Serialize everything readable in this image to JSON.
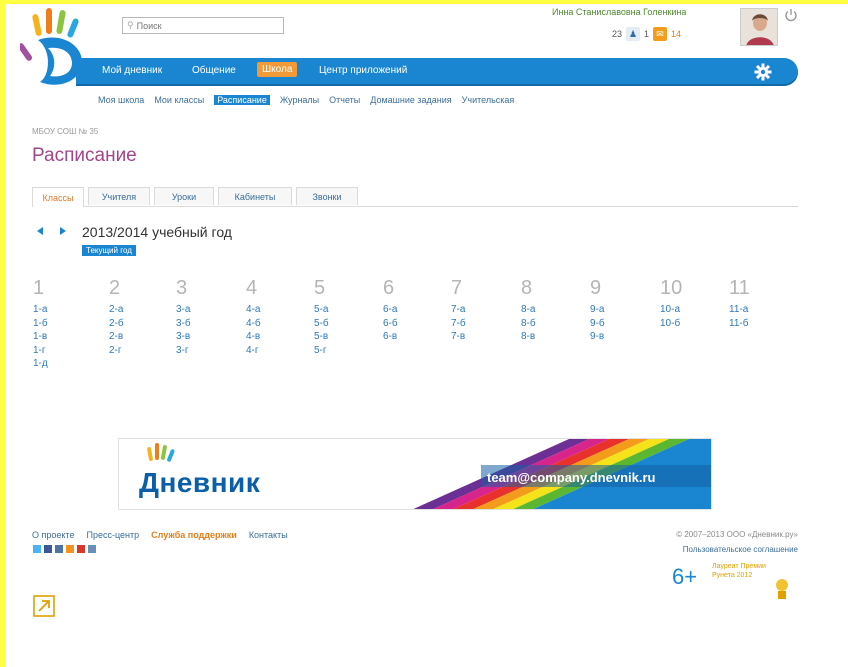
{
  "search": {
    "placeholder": "Поиск"
  },
  "user": {
    "name": "Инна Станиславовна Голенкина",
    "count_left": "23",
    "count_mid": "1",
    "count_messages": "14"
  },
  "nav": {
    "items": [
      "Мой дневник",
      "Общение",
      "Школа",
      "Центр приложений"
    ],
    "active": "Школа"
  },
  "subnav": {
    "items": [
      "Моя школа",
      "Мои классы",
      "Расписание",
      "Журналы",
      "Отчеты",
      "Домашние задания",
      "Учительская"
    ],
    "active": "Расписание"
  },
  "breadcrumb": "МБОУ СОШ № 35",
  "page_title": "Расписание",
  "tabs": {
    "items": [
      "Классы",
      "Учителя",
      "Уроки",
      "Кабинеты",
      "Звонки"
    ],
    "active": "Классы"
  },
  "year": {
    "label": "2013/2014 учебный год",
    "current": "Текущий год"
  },
  "grades": [
    {
      "num": "1",
      "classes": [
        "1-а",
        "1-б",
        "1-в",
        "1-г",
        "1-д"
      ]
    },
    {
      "num": "2",
      "classes": [
        "2-а",
        "2-б",
        "2-в",
        "2-г"
      ]
    },
    {
      "num": "3",
      "classes": [
        "3-а",
        "3-б",
        "3-в",
        "3-г"
      ]
    },
    {
      "num": "4",
      "classes": [
        "4-а",
        "4-б",
        "4-в",
        "4-г"
      ]
    },
    {
      "num": "5",
      "classes": [
        "5-а",
        "5-б",
        "5-в",
        "5-г"
      ]
    },
    {
      "num": "6",
      "classes": [
        "6-а",
        "6-б",
        "6-в"
      ]
    },
    {
      "num": "7",
      "classes": [
        "7-а",
        "7-б",
        "7-в"
      ]
    },
    {
      "num": "8",
      "classes": [
        "8-а",
        "8-б",
        "8-в"
      ]
    },
    {
      "num": "9",
      "classes": [
        "9-а",
        "9-б",
        "9-в"
      ]
    },
    {
      "num": "10",
      "classes": [
        "10-а",
        "10-б"
      ]
    },
    {
      "num": "11",
      "classes": [
        "11-а",
        "11-б"
      ]
    }
  ],
  "banner": {
    "brand": "Дневник",
    "email": "team@company.dnevnik.ru"
  },
  "footer": {
    "links": [
      "О проекте",
      "Пресс-центр",
      "Служба поддержки",
      "Контакты"
    ],
    "copyright": "© 2007–2013 ООО «Дневник.ру»",
    "agreement": "Пользовательское соглашение",
    "age": "6+",
    "award": "Лауреат Премии Рунета 2012"
  },
  "colors": {
    "brand_blue": "#1a86d1",
    "accent_orange": "#f19a37",
    "title_purple": "#a2458a"
  },
  "icons": [
    "search-icon",
    "power-icon",
    "person-icon",
    "mail-icon",
    "gear-icon",
    "twitter-icon",
    "facebook-icon",
    "vk-icon",
    "ok-icon",
    "youtube-icon",
    "rss-icon",
    "external-link-icon",
    "award-icon"
  ]
}
